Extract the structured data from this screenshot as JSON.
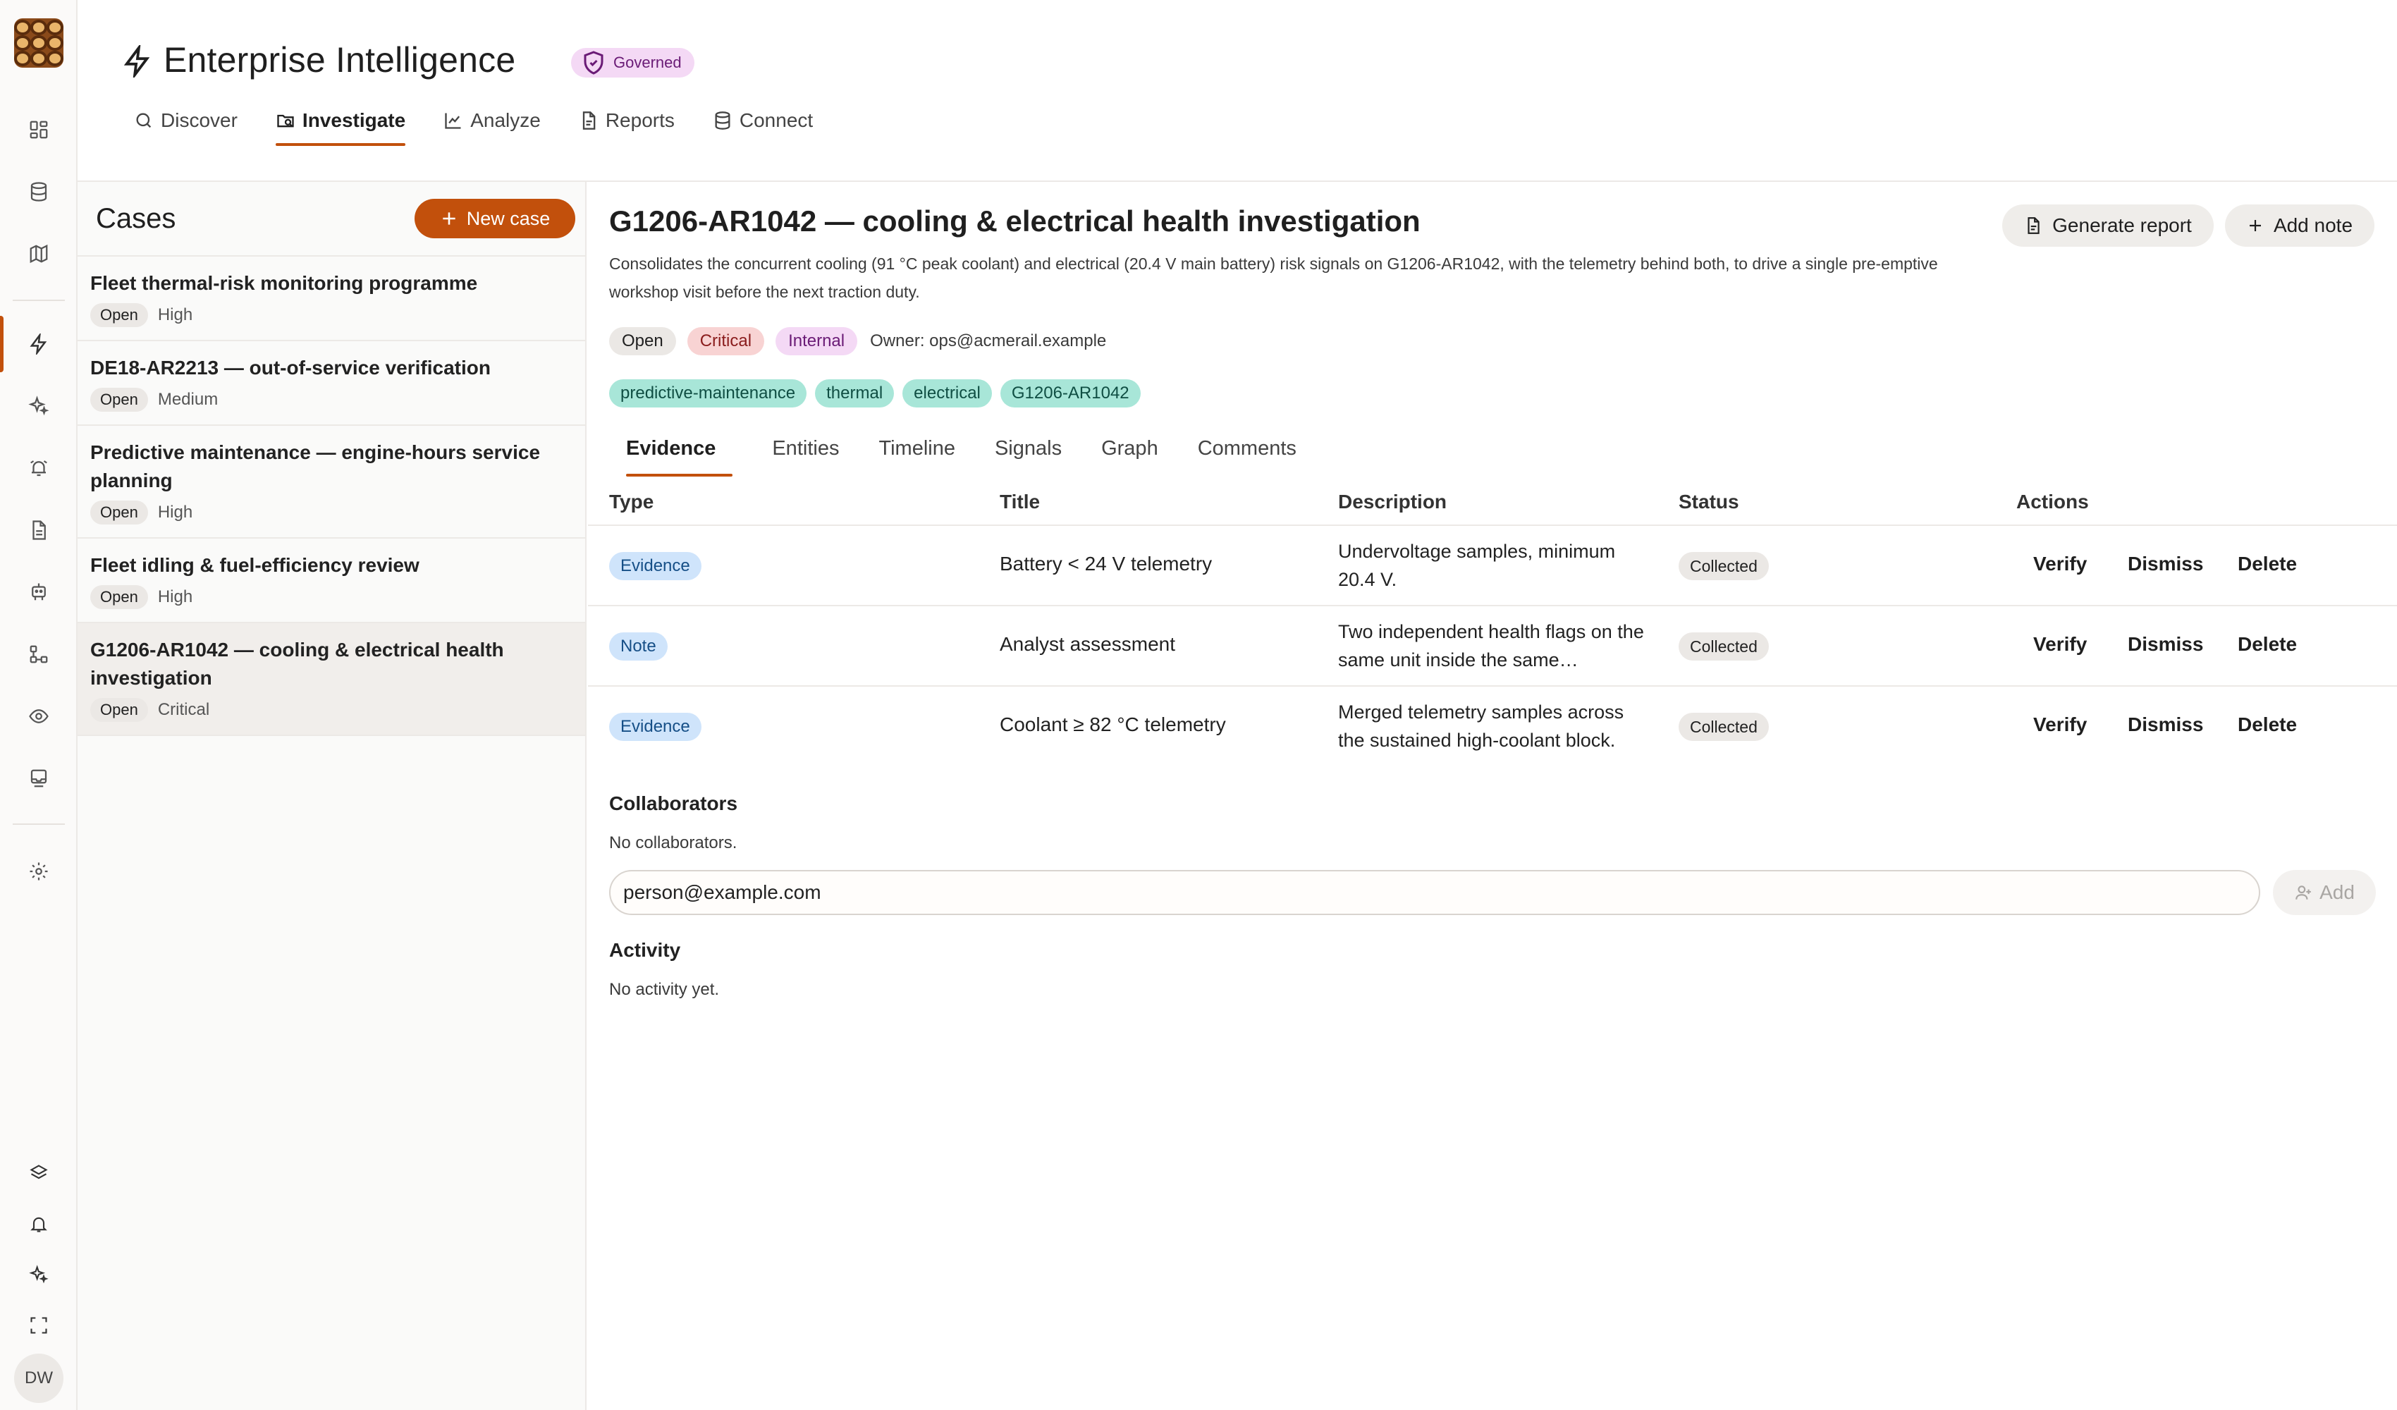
{
  "app": {
    "title": "Enterprise Intelligence",
    "badge": "Governed",
    "brand_color": "#c2500c"
  },
  "nav": {
    "items": [
      {
        "label": "Discover",
        "icon": "search-icon"
      },
      {
        "label": "Investigate",
        "icon": "folder-search-icon",
        "active": true
      },
      {
        "label": "Analyze",
        "icon": "chart-icon"
      },
      {
        "label": "Reports",
        "icon": "document-icon"
      },
      {
        "label": "Connect",
        "icon": "database-icon"
      }
    ]
  },
  "rail": {
    "icons": [
      "dashboard-icon",
      "database-icon",
      "map-icon",
      "bolt-icon",
      "sparkles-icon",
      "alarm-icon",
      "document-icon",
      "robot-icon",
      "workflow-icon",
      "eye-icon",
      "inbox-icon",
      "settings-icon"
    ],
    "bottom_icons": [
      "layers-icon",
      "bell-icon",
      "sparkles-icon",
      "fullscreen-icon"
    ],
    "avatar": "DW"
  },
  "cases": {
    "title": "Cases",
    "new_label": "New case",
    "items": [
      {
        "title": "Fleet thermal-risk monitoring programme",
        "status": "Open",
        "priority": "High"
      },
      {
        "title": "DE18-AR2213 — out-of-service verification",
        "status": "Open",
        "priority": "Medium"
      },
      {
        "title": "Predictive maintenance — engine-hours service planning",
        "status": "Open",
        "priority": "High"
      },
      {
        "title": "Fleet idling & fuel-efficiency review",
        "status": "Open",
        "priority": "High"
      },
      {
        "title": "G1206-AR1042 — cooling & electrical health investigation",
        "status": "Open",
        "priority": "Critical",
        "selected": true
      }
    ]
  },
  "detail": {
    "title": "G1206-AR1042 — cooling & electrical health investigation",
    "description": "Consolidates the concurrent cooling (91 °C peak coolant) and electrical (20.4 V main battery) risk signals on G1206-AR1042, with the telemetry behind both, to drive a single pre-emptive workshop visit before the next traction duty.",
    "generate_report": "Generate report",
    "add_note": "Add note",
    "status": "Open",
    "severity": "Critical",
    "classification": "Internal",
    "owner": "Owner: ops@acmerail.example",
    "tags": [
      "predictive-maintenance",
      "thermal",
      "electrical",
      "G1206-AR1042"
    ],
    "tabs": [
      "Evidence",
      "Entities",
      "Timeline",
      "Signals",
      "Graph",
      "Comments"
    ],
    "table": {
      "columns": [
        "Type",
        "Title",
        "Description",
        "Status",
        "Actions"
      ],
      "rows": [
        {
          "type": "Evidence",
          "title": "Battery < 24 V telemetry",
          "description": "Undervoltage samples, minimum 20.4 V.",
          "status": "Collected"
        },
        {
          "type": "Note",
          "title": "Analyst assessment",
          "description": "Two independent health flags on the same unit inside the same…",
          "status": "Collected"
        },
        {
          "type": "Evidence",
          "title": "Coolant ≥ 82 °C telemetry",
          "description": "Merged telemetry samples across the sustained high-coolant block.",
          "status": "Collected"
        }
      ],
      "actions": [
        "Verify",
        "Dismiss",
        "Delete"
      ]
    },
    "collaborators": {
      "title": "Collaborators",
      "empty": "No collaborators.",
      "input_value": "person@example.com",
      "add_label": "Add"
    },
    "activity": {
      "title": "Activity",
      "empty": "No activity yet."
    }
  }
}
